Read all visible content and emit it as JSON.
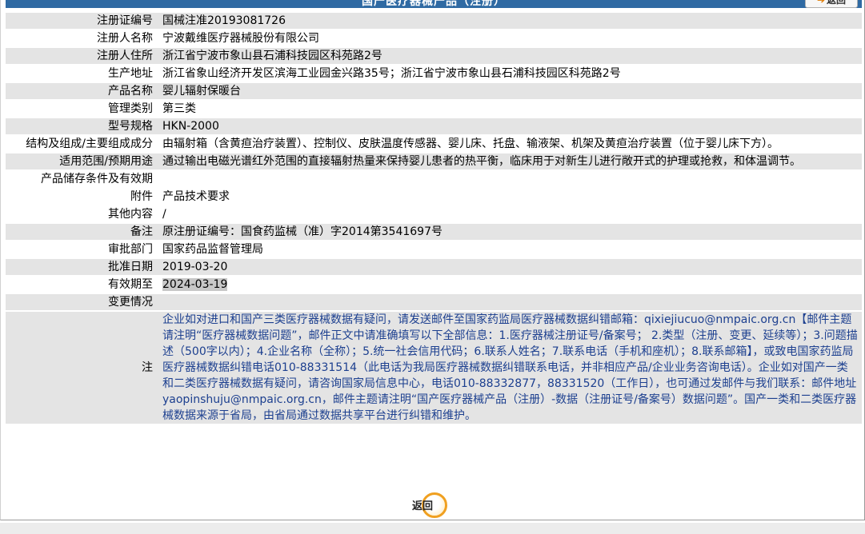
{
  "header": {
    "title": "国产医疗器械产品（注册）",
    "back_label": "返回"
  },
  "rows": [
    {
      "label": "注册证编号",
      "value": "国械注准20193081726"
    },
    {
      "label": "注册人名称",
      "value": "宁波戴维医疗器械股份有限公司"
    },
    {
      "label": "注册人住所",
      "value": "浙江省宁波市象山县石浦科技园区科苑路2号"
    },
    {
      "label": "生产地址",
      "value": "浙江省象山经济开发区滨海工业园金兴路35号；浙江省宁波市象山县石浦科技园区科苑路2号"
    },
    {
      "label": "产品名称",
      "value": "婴儿辐射保暖台"
    },
    {
      "label": "管理类别",
      "value": "第三类"
    },
    {
      "label": "型号规格",
      "value": "HKN-2000"
    },
    {
      "label": "结构及组成/主要组成成分",
      "value": "由辐射箱（含黄疸治疗装置）、控制仪、皮肤温度传感器、婴儿床、托盘、输液架、机架及黄疸治疗装置（位于婴儿床下方）。"
    },
    {
      "label": "适用范围/预期用途",
      "value": "通过输出电磁光谱红外范围的直接辐射热量来保持婴儿患者的热平衡，临床用于对新生儿进行敞开式的护理或抢救，和体温调节。"
    },
    {
      "label": "产品储存条件及有效期",
      "value": ""
    },
    {
      "label": "附件",
      "value": "产品技术要求"
    },
    {
      "label": "其他内容",
      "value": "/"
    },
    {
      "label": "备注",
      "value": "原注册证编号：国食药监械（准）字2014第3541697号"
    },
    {
      "label": "审批部门",
      "value": "国家药品监督管理局"
    },
    {
      "label": "批准日期",
      "value": "2019-03-20"
    },
    {
      "label": "有效期至",
      "value": "2024-03-19"
    },
    {
      "label": "变更情况",
      "value": ""
    }
  ],
  "note": {
    "label": "注",
    "text": "企业如对进口和国产三类医疗器械数据有疑问，请发送邮件至国家药监局医疗器械数据纠错邮箱：qixiejiucuo@nmpaic.org.cn【邮件主题请注明“医疗器械数据问题”，邮件正文中请准确填写以下全部信息：1.医疗器械注册证号/备案号； 2.类型（注册、变更、延续等）；3.问题描述（500字以内）；4.企业名称（全称）；5.统一社会信用代码；6.联系人姓名；7.联系电话（手机和座机）；8.联系邮箱】，或致电国家药监局医疗器械数据纠错电话010-88331514（此电话为我局医疗器械数据纠错联系电话，并非相应产品/企业业务咨询电话）。企业如对国产一类和二类医疗器械数据有疑问，请咨询国家局信息中心，电话010-88332877，88331520（工作日），也可通过发邮件与我们联系：邮件地址yaopinshuju@nmpaic.org.cn，邮件主题请注明“国产医疗器械产品（注册）-数据（注册证号/备案号）数据问题”。国产一类和二类医疗器械数据来源于省局，由省局通过数据共享平台进行纠错和维护。"
  },
  "footer": {
    "back_label": "返回"
  }
}
